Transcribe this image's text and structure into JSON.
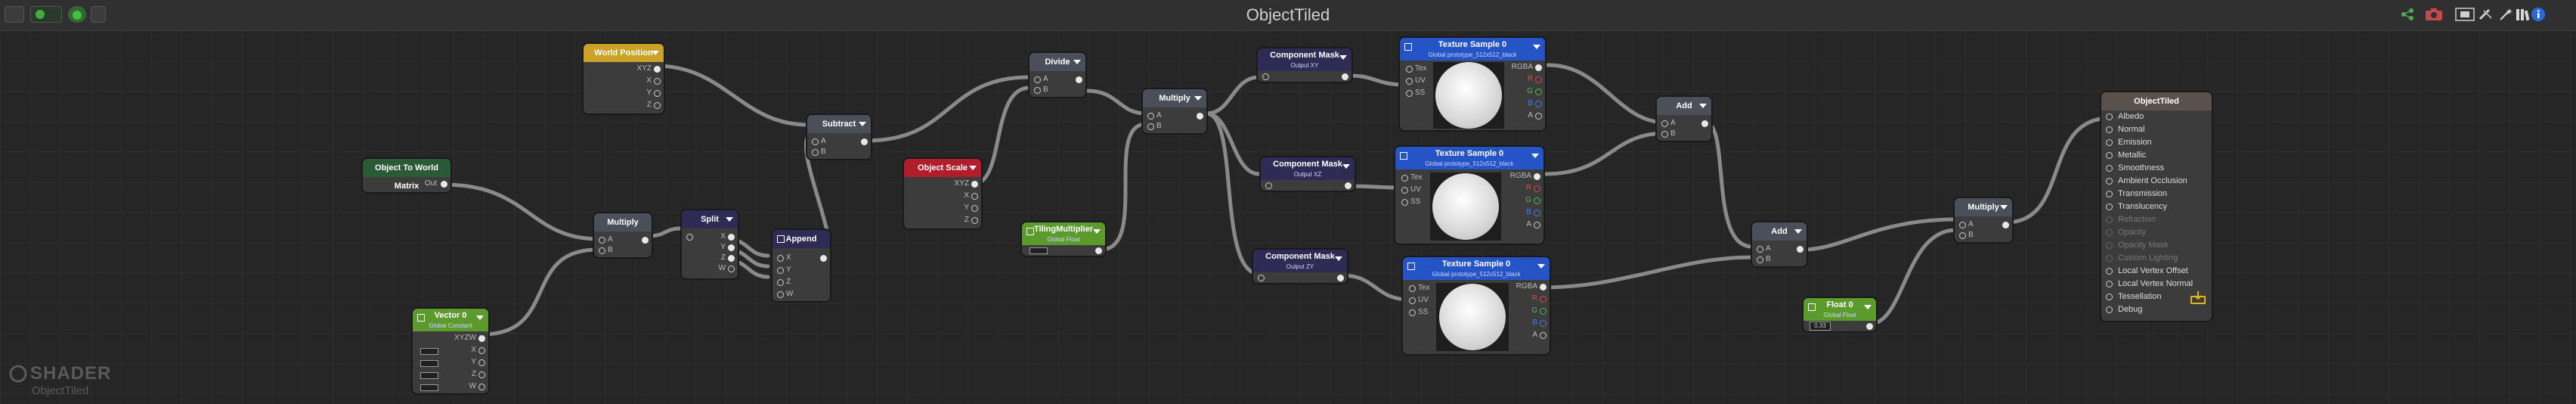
{
  "window": {
    "title": "ObjectTiled"
  },
  "brand": {
    "line1": "SHADER",
    "line2": "ObjectTiled"
  },
  "colors": {
    "blue_header": "#2554c7",
    "gray_header": "#4a4f5a",
    "dark_purple_header": "#2e2b55",
    "green_header": "#5c9a2e",
    "yellow_header": "#c9a227",
    "red_header": "#b01e2c",
    "teal_header": "#2b5a36",
    "output_header": "#5a524a"
  },
  "nodes": {
    "world_position": {
      "title": "World Position",
      "ports": [
        "XYZ",
        "X",
        "Y",
        "Z"
      ]
    },
    "object_to_world": {
      "title": "Object To World Matrix",
      "out": "Out"
    },
    "multiply1": {
      "title": "Multiply",
      "ports": [
        "A",
        "B"
      ]
    },
    "vector0": {
      "title": "Vector 0",
      "sub": "Global Constant",
      "ports": [
        "XYZW",
        "X",
        "Y",
        "Z",
        "W"
      ]
    },
    "split": {
      "title": "Split",
      "ports": [
        "X",
        "Y",
        "Z",
        "W"
      ]
    },
    "append": {
      "title": "Append",
      "ports": [
        "X",
        "Y",
        "Z",
        "W"
      ]
    },
    "subtract": {
      "title": "Subtract",
      "ports": [
        "A",
        "B"
      ]
    },
    "object_scale": {
      "title": "Object Scale",
      "ports": [
        "XYZ",
        "X",
        "Y",
        "Z"
      ]
    },
    "divide": {
      "title": "Divide",
      "ports": [
        "A",
        "B"
      ]
    },
    "tiling": {
      "title": "TilingMultiplier",
      "sub": "Global Float"
    },
    "multiply2": {
      "title": "Multiply",
      "ports": [
        "A",
        "B"
      ]
    },
    "cm1": {
      "title": "Component Mask",
      "sub": "Output XY"
    },
    "cm2": {
      "title": "Component Mask",
      "sub": "Output XZ"
    },
    "cm3": {
      "title": "Component Mask",
      "sub": "Output ZY"
    },
    "tex1": {
      "title": "Texture Sample 0",
      "sub": "Global prototype_512x512_black",
      "ports": [
        "Tex",
        "UV",
        "SS"
      ],
      "outs": [
        "RGBA",
        "R",
        "G",
        "B",
        "A"
      ]
    },
    "tex2": {
      "title": "Texture Sample 0",
      "sub": "Global prototype_512x512_black",
      "ports": [
        "Tex",
        "UV",
        "SS"
      ],
      "outs": [
        "RGBA",
        "R",
        "G",
        "B",
        "A"
      ]
    },
    "tex3": {
      "title": "Texture Sample 0",
      "sub": "Global prototype_512x512_black",
      "ports": [
        "Tex",
        "UV",
        "SS"
      ],
      "outs": [
        "RGBA",
        "R",
        "G",
        "B",
        "A"
      ]
    },
    "add1": {
      "title": "Add",
      "ports": [
        "A",
        "B"
      ]
    },
    "add2": {
      "title": "Add",
      "ports": [
        "A",
        "B"
      ]
    },
    "float0": {
      "title": "Float 0",
      "sub": "Global Float",
      "value": "0.33"
    },
    "multiply3": {
      "title": "Multiply",
      "ports": [
        "A",
        "B"
      ]
    },
    "output": {
      "title": "ObjectTiled",
      "inputs": [
        "Albedo",
        "Normal",
        "Emission",
        "Metallic",
        "Smoothness",
        "Ambient Occlusion",
        "Transmission",
        "Translucency",
        "Refraction",
        "Opacity",
        "Opacity Mask",
        "Custom Lighting",
        "Local Vertex Offset",
        "Local Vertex Normal",
        "Tessellation",
        "Debug"
      ],
      "disabled": [
        8,
        9,
        10,
        11
      ]
    }
  }
}
